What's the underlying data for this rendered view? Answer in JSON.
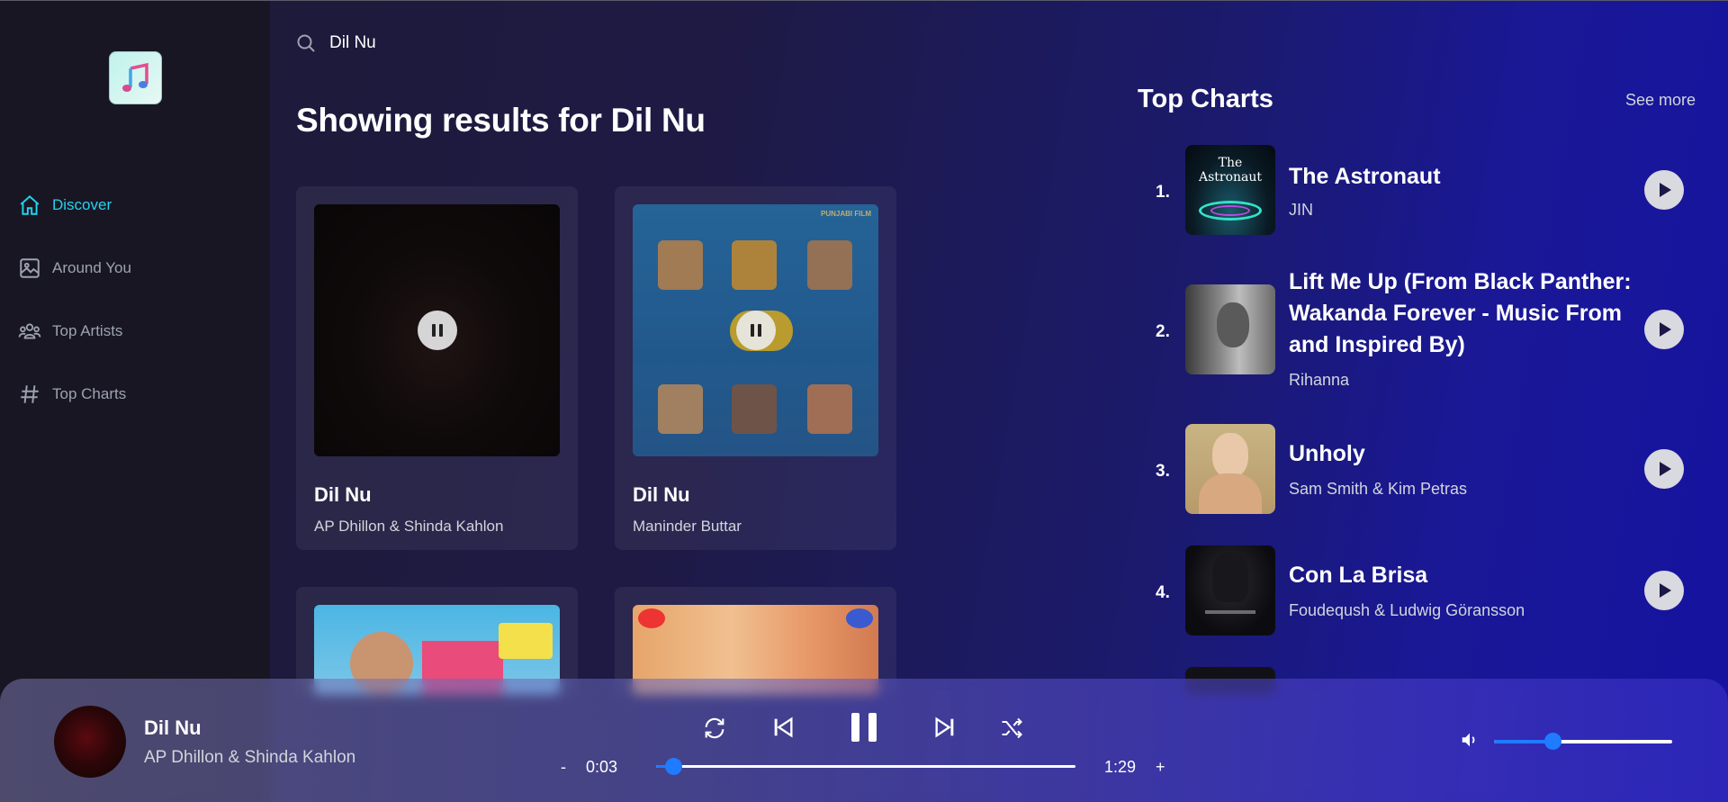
{
  "search": {
    "value": "Dil Nu",
    "icon": "search-icon"
  },
  "sidebar": {
    "items": [
      {
        "label": "Discover",
        "icon": "home-icon",
        "active": true
      },
      {
        "label": "Around You",
        "icon": "image-icon",
        "active": false
      },
      {
        "label": "Top Artists",
        "icon": "users-icon",
        "active": false
      },
      {
        "label": "Top Charts",
        "icon": "hashtag-icon",
        "active": false
      }
    ]
  },
  "results": {
    "prefix": "Showing results for ",
    "query": "Dil Nu",
    "cards": [
      {
        "title": "Dil Nu",
        "artist": "AP Dhillon & Shinda Kahlon",
        "playing": true
      },
      {
        "title": "Dil Nu",
        "artist": "Maninder Buttar",
        "playing": true,
        "poster_top_label": "PUNJABI FILM"
      }
    ]
  },
  "top_charts": {
    "title": "Top Charts",
    "see_more": "See more",
    "items": [
      {
        "rank": "1.",
        "title": "The Astronaut",
        "artist": "JIN",
        "cover_text": "The Astronaut"
      },
      {
        "rank": "2.",
        "title": "Lift Me Up (From Black Panther: Wakanda Forever - Music From and Inspired By)",
        "artist": "Rihanna"
      },
      {
        "rank": "3.",
        "title": "Unholy",
        "artist": "Sam Smith & Kim Petras"
      },
      {
        "rank": "4.",
        "title": "Con La Brisa",
        "artist": "Foudeqush & Ludwig Göransson"
      }
    ]
  },
  "player": {
    "title": "Dil Nu",
    "artist": "AP Dhillon & Shinda Kahlon",
    "current_time": "0:03",
    "duration": "1:29",
    "minus": "-",
    "plus": "+",
    "progress": 0.04,
    "volume": 0.33
  },
  "colors": {
    "accent": "#22d3ee",
    "slider": "#1f7bff"
  }
}
